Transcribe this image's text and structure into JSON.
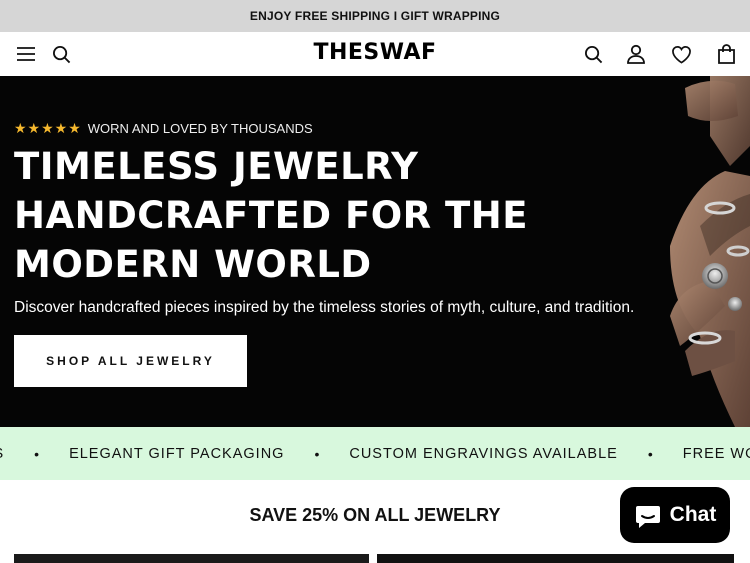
{
  "announcement": {
    "text": "ENJOY FREE SHIPPING I GIFT WRAPPING"
  },
  "header": {
    "logo": "THESWAF",
    "icons": [
      "menu-icon",
      "search-icon",
      "account-icon",
      "wishlist-icon",
      "cart-icon"
    ]
  },
  "hero": {
    "stars": "★★★★★",
    "rating_text": "WORN AND LOVED BY THOUSANDS",
    "headline_line1": "TIMELESS JEWELRY",
    "headline_line2": "HANDCRAFTED FOR THE",
    "headline_line3": "MODERN WORLD",
    "subheading": "Discover handcrafted pieces inspired by the timeless stories of myth, culture, and tradition.",
    "cta_label": "SHOP ALL JEWELRY",
    "image": "hand-with-silver-rings"
  },
  "ticker": {
    "items": [
      "RS",
      "ELEGANT GIFT PACKAGING",
      "CUSTOM ENGRAVINGS AVAILABLE",
      "FREE WO"
    ],
    "separator": "•"
  },
  "promo": {
    "title": "SAVE 25% ON ALL JEWELRY"
  },
  "chat": {
    "label": "Chat",
    "icon": "chat-bubble-icon"
  },
  "colors": {
    "ticker_bg": "#d8f8dd",
    "announcement_bg": "#d6d6d6",
    "hero_bg": "#050505",
    "stars": "#f5b82e"
  }
}
